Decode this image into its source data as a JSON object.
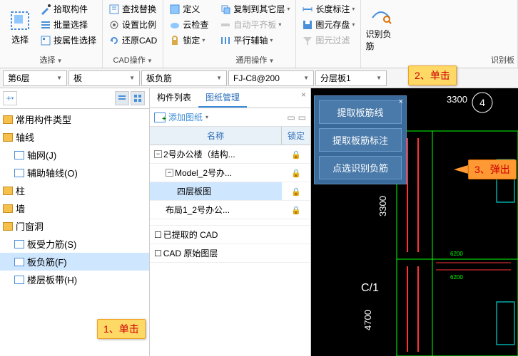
{
  "ribbon": {
    "select_group": {
      "big": "选择",
      "items": [
        "拾取构件",
        "批量选择",
        "按属性选择"
      ],
      "title": "选择"
    },
    "cad_group": {
      "items": [
        "查找替换",
        "设置比例",
        "还原CAD"
      ],
      "title": "CAD操作"
    },
    "def_group": {
      "items": [
        "定义",
        "云检查",
        "锁定"
      ]
    },
    "copy_group": {
      "items": [
        "复制到其它层",
        "自动平齐板",
        "平行辅轴"
      ],
      "title": "通用操作"
    },
    "dim_group": {
      "items": [
        "长度标注",
        "图元存盘",
        "图元过滤"
      ]
    },
    "recognize_big": "识别负筋",
    "recognize_title": "识别板"
  },
  "dropdowns": {
    "floor": "第6层",
    "type": "板",
    "sub": "板负筋",
    "spec": "FJ-C8@200",
    "layer": "分层板1"
  },
  "tree": {
    "items": [
      {
        "label": "常用构件类型",
        "cls": "fld",
        "indent": 0
      },
      {
        "label": "轴线",
        "cls": "fld",
        "indent": 0
      },
      {
        "label": "轴网(J)",
        "cls": "sheet",
        "indent": 1
      },
      {
        "label": "辅助轴线(O)",
        "cls": "sheet",
        "indent": 1
      },
      {
        "label": "柱",
        "cls": "fld",
        "indent": 0
      },
      {
        "label": "墙",
        "cls": "fld",
        "indent": 0
      },
      {
        "label": "门窗洞",
        "cls": "fld",
        "indent": 0
      },
      {
        "label": "板受力筋(S)",
        "cls": "sheet",
        "indent": 1
      },
      {
        "label": "板负筋(F)",
        "cls": "sheet",
        "indent": 1,
        "sel": true
      },
      {
        "label": "楼层板带(H)",
        "cls": "sheet",
        "indent": 1
      }
    ]
  },
  "mid": {
    "tabs": [
      "构件列表",
      "图纸管理"
    ],
    "add_drawing": "添加图纸",
    "cols": [
      "名称",
      "锁定"
    ],
    "rows": [
      {
        "name": "2号办公楼（结构...",
        "lock": true,
        "exp": "−",
        "indent": 0
      },
      {
        "name": "Model_2号办...",
        "lock": true,
        "exp": "−",
        "indent": 1
      },
      {
        "name": "四层板图",
        "lock": true,
        "indent": 2,
        "sel": true
      },
      {
        "name": "布局1_2号办公...",
        "lock": true,
        "indent": 1
      },
      {
        "name": "",
        "blank": true
      },
      {
        "name": "已提取的 CAD",
        "chk": true
      },
      {
        "name": "CAD 原始图层",
        "chk": true
      }
    ]
  },
  "popup": {
    "items": [
      "提取板筋线",
      "提取板筋标注",
      "点选识别负筋"
    ]
  },
  "cad": {
    "label_top": "3300",
    "label_num": "4",
    "label_left": "3300",
    "label_axis": "C/1",
    "label_bottom": "4700"
  },
  "annotations": {
    "a1": "1、单击",
    "a2": "2、单击",
    "a3": "3、弹出"
  }
}
